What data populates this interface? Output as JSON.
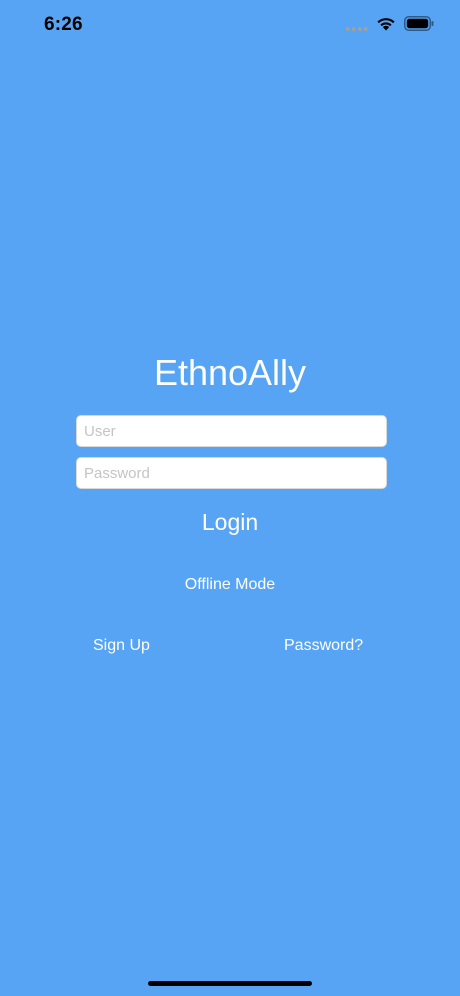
{
  "status_bar": {
    "time": "6:26",
    "icons": [
      "cellular-signal-icon",
      "wifi-icon",
      "battery-icon"
    ]
  },
  "login": {
    "app_title": "EthnoAlly",
    "user_placeholder": "User",
    "user_value": "",
    "password_placeholder": "Password",
    "password_value": "",
    "login_label": "Login",
    "offline_label": "Offline Mode",
    "signup_label": "Sign Up",
    "forgot_password_label": "Password?"
  },
  "colors": {
    "background": "#56a4f3",
    "text": "#ffffff",
    "field_background": "#ffffff",
    "placeholder": "#c4c4c6",
    "status_text": "#000000"
  }
}
